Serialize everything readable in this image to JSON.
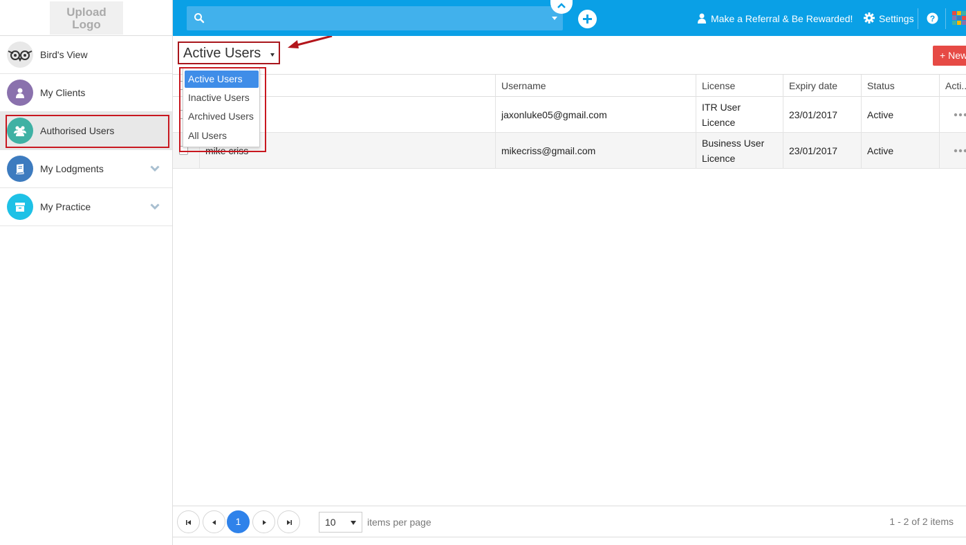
{
  "brand": {
    "logo_text_line1": "Upload",
    "logo_text_line2": "Logo",
    "primary_color": "#0aa0e6",
    "accent_red": "#c8171f"
  },
  "header": {
    "search_placeholder": "",
    "referral_label": "Make a Referral & Be Rewarded!",
    "settings_label": "Settings"
  },
  "sidebar": {
    "items": [
      {
        "label": "Bird's View",
        "icon": "owl-icon",
        "color": "#e8e8e8"
      },
      {
        "label": "My Clients",
        "icon": "user-icon",
        "color": "#8a71ad"
      },
      {
        "label": "Authorised Users",
        "icon": "users-icon",
        "color": "#3fb1a4",
        "active": true
      },
      {
        "label": "My Lodgments",
        "icon": "book-icon",
        "color": "#3d7bbf",
        "expandable": true
      },
      {
        "label": "My Practice",
        "icon": "archive-icon",
        "color": "#1ec1e6",
        "expandable": true
      }
    ]
  },
  "view": {
    "selected": "Active Users",
    "options": [
      "Active Users",
      "Inactive Users",
      "Archived Users",
      "All Users"
    ],
    "new_label": "New"
  },
  "table": {
    "columns": [
      "",
      "Username",
      "License",
      "Expiry date",
      "Status",
      "Acti..."
    ],
    "rows": [
      {
        "name": "",
        "username": "jaxonluke05@gmail.com",
        "license_line1": "ITR User",
        "license_line2": "Licence",
        "expiry": "23/01/2017",
        "status": "Active"
      },
      {
        "name": "mike criss",
        "username": "mikecriss@gmail.com",
        "license_line1": "Business User",
        "license_line2": "Licence",
        "expiry": "23/01/2017",
        "status": "Active"
      }
    ]
  },
  "pager": {
    "current_page": "1",
    "page_size": "10",
    "items_per_page_label": "items per page",
    "info": "1 - 2 of 2 items"
  }
}
